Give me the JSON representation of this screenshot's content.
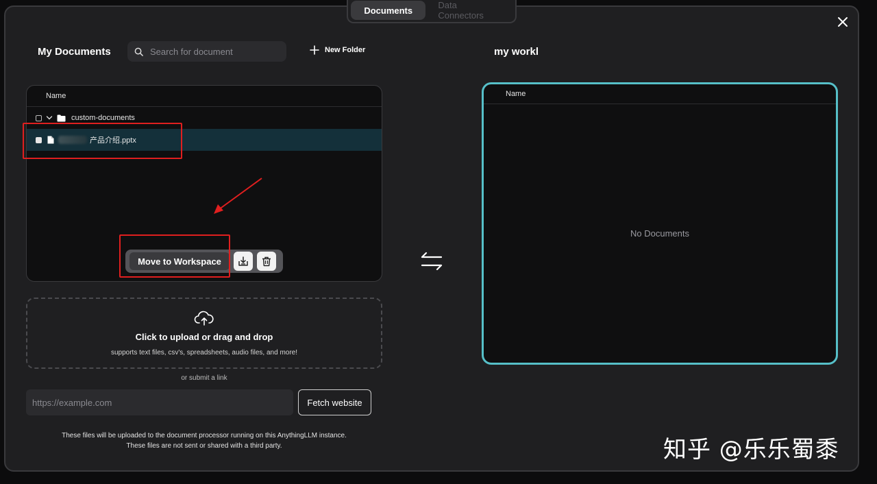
{
  "tabs": [
    {
      "label": "Documents",
      "active": true
    },
    {
      "label": "Data Connectors",
      "active": false
    }
  ],
  "left": {
    "title": "My Documents",
    "search_placeholder": "Search for document",
    "new_folder_label": "New Folder",
    "column_name": "Name",
    "folder": {
      "name": "custom-documents",
      "expanded": true
    },
    "file": {
      "name": "产品介绍.pptx",
      "selected": true
    },
    "actions": {
      "move_label": "Move to Workspace",
      "save_icon": "save-embed-icon",
      "delete_icon": "trash-icon"
    }
  },
  "upload": {
    "title": "Click to upload or drag and drop",
    "subtitle": "supports text files, csv's, spreadsheets, audio files, and more!",
    "or_link": "or submit a link",
    "url_placeholder": "https://example.com",
    "fetch_label": "Fetch website",
    "note_line1": "These files will be uploaded to the document processor running on this AnythingLLM instance.",
    "note_line2": "These files are not sent or shared with a third party."
  },
  "workspace": {
    "title": "my workl",
    "column_name": "Name",
    "empty_text": "No Documents"
  },
  "watermark": "知乎 @乐乐蜀黍",
  "colors": {
    "accent": "#56bfc8",
    "annotation": "#e01f1f",
    "selected_row": "#14303a"
  }
}
